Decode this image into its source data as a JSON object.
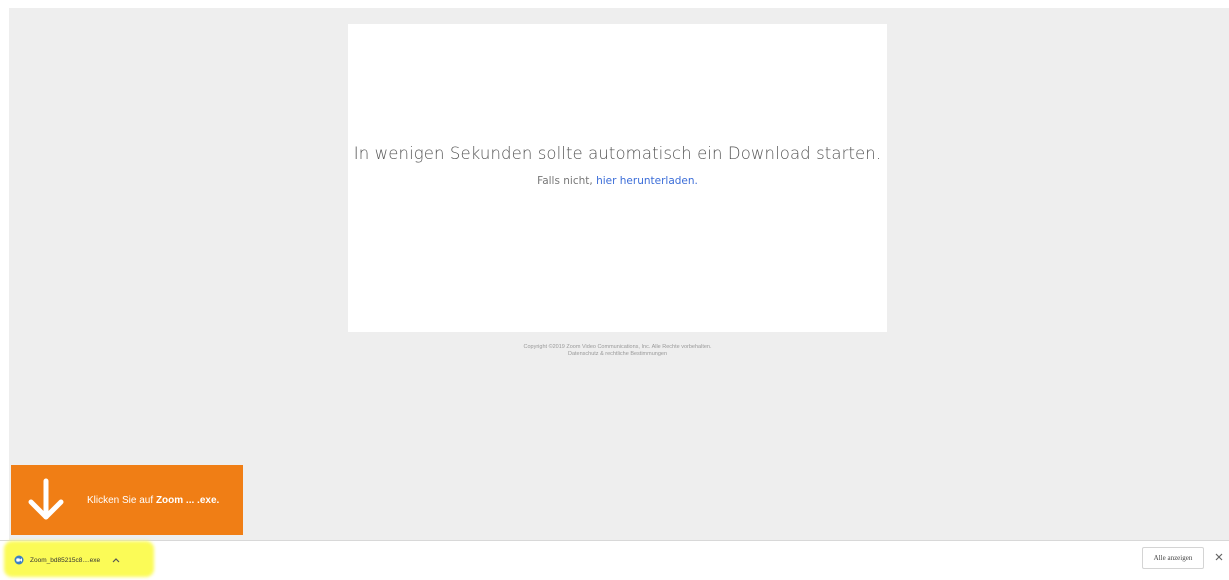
{
  "page": {
    "headline": "In wenigen Sekunden sollte automatisch ein Download starten.",
    "fallback_prefix": "Falls nicht, ",
    "fallback_link": "hier herunterladen."
  },
  "footer": {
    "copyright": "Copyright ©2019 Zoom Video Communications, Inc. Alle Rechte vorbehalten.",
    "legal": "Datenschutz & rechtliche Bestimmungen"
  },
  "toast": {
    "text_prefix": "Klicken Sie auf ",
    "text_bold": "Zoom ... .exe.",
    "icon": "download-arrow-icon",
    "color": "#f07e15"
  },
  "download_bar": {
    "file_name": "Zoom_bd85215c8....exe",
    "show_all_label": "Alle anzeigen",
    "highlight_color": "#fbfb57"
  }
}
